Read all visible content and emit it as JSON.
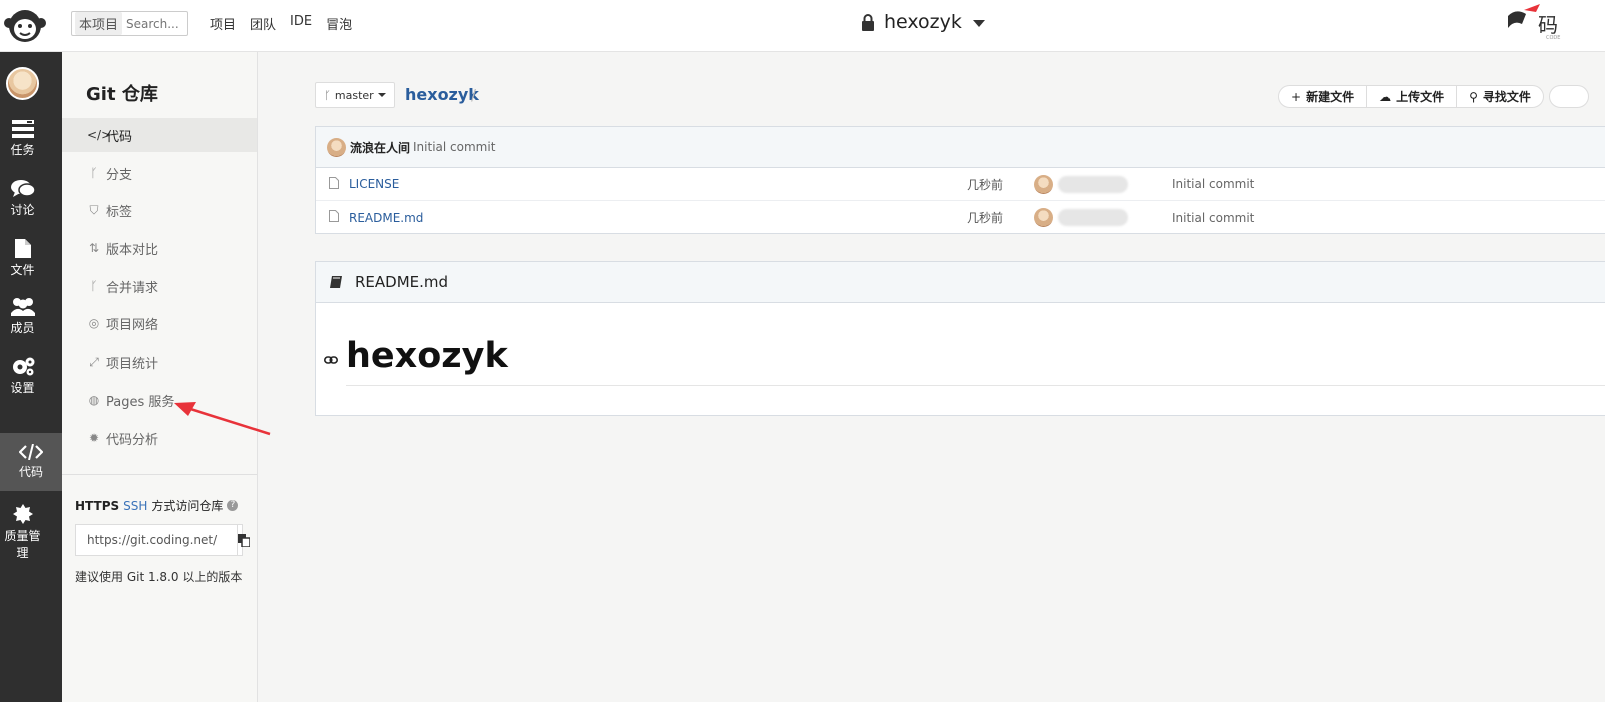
{
  "topbar": {
    "search_scope": "本项目",
    "search_placeholder": "Search...",
    "nav": [
      "项目",
      "团队",
      "IDE",
      "冒泡"
    ],
    "project_name": "hexozyk"
  },
  "rail": {
    "items": [
      {
        "label": "任务",
        "icon": "tasks-icon"
      },
      {
        "label": "讨论",
        "icon": "chat-icon"
      },
      {
        "label": "文件",
        "icon": "file-icon"
      },
      {
        "label": "成员",
        "icon": "members-icon"
      },
      {
        "label": "设置",
        "icon": "gear-icon"
      },
      {
        "label": "代码",
        "icon": "code-icon"
      },
      {
        "label": "质量管理",
        "icon": "quality-icon"
      }
    ]
  },
  "sidebar": {
    "title": "Git 仓库",
    "items": [
      {
        "label": "代码",
        "icon": "</>"
      },
      {
        "label": "分支",
        "icon": "ᚴ"
      },
      {
        "label": "标签",
        "icon": "⛉"
      },
      {
        "label": "版本对比",
        "icon": "⇅"
      },
      {
        "label": "合并请求",
        "icon": "ᚴ"
      },
      {
        "label": "项目网络",
        "icon": "◎"
      },
      {
        "label": "项目统计",
        "icon": "⤢"
      },
      {
        "label": "Pages 服务",
        "icon": "◍"
      },
      {
        "label": "代码分析",
        "icon": "✹"
      }
    ],
    "clone": {
      "https": "HTTPS",
      "ssh": "SSH",
      "text": "方式访问仓库",
      "help": "?",
      "url": "https://git.coding.net/",
      "hint": "建议使用 Git 1.8.0 以上的版本"
    }
  },
  "main": {
    "branch": "master",
    "repo": "hexozyk",
    "crumb_sep": "/",
    "toolbar": [
      {
        "label": "新建文件",
        "icon": "+"
      },
      {
        "label": "上传文件",
        "icon": "☁"
      },
      {
        "label": "寻找文件",
        "icon": "⚲"
      }
    ],
    "commit": {
      "author": "流浪在人间",
      "message": "Initial commit"
    },
    "files": [
      {
        "name": "LICENSE",
        "time": "几秒前",
        "message": "Initial commit"
      },
      {
        "name": "README.md",
        "time": "几秒前",
        "message": "Initial commit"
      }
    ],
    "readme": {
      "filename": "README.md",
      "heading": "hexozyk"
    }
  },
  "colors": {
    "accent": "#2a5d9c",
    "rail_bg": "#2f2f2f",
    "annotation": "#e8333a"
  }
}
